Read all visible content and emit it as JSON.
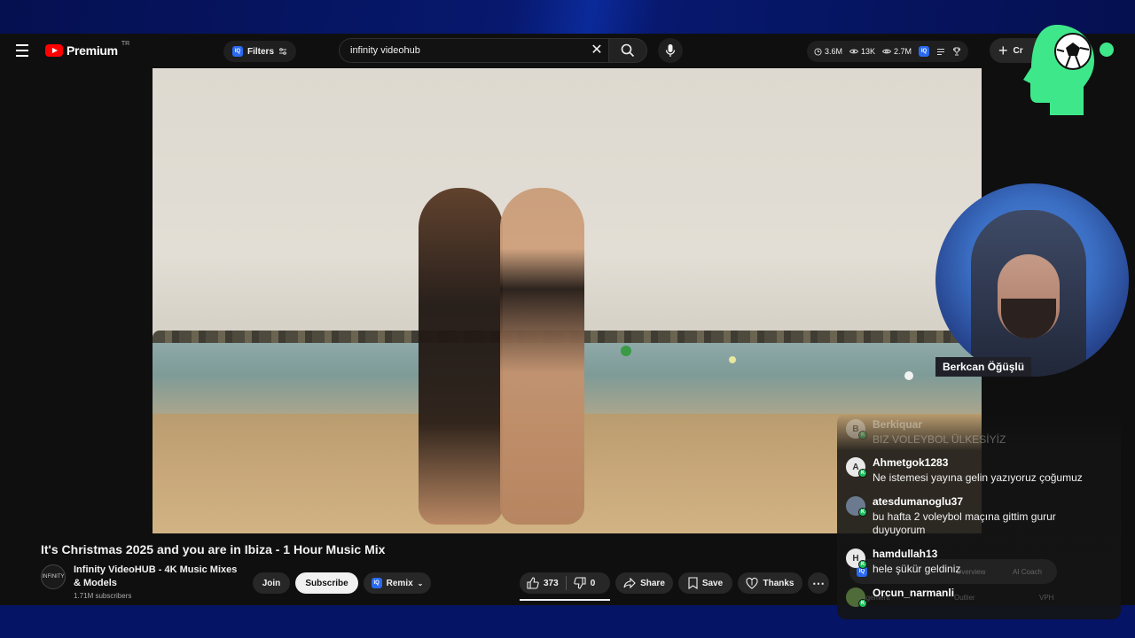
{
  "header": {
    "brand": "Premium",
    "region": "TR",
    "filters_label": "Filters",
    "search_value": "infinity videohub",
    "stats": [
      {
        "icon": "clock-icon",
        "value": "3.6M"
      },
      {
        "icon": "eye-icon",
        "value": "13K"
      },
      {
        "icon": "eye-outline-icon",
        "value": "2.7M"
      }
    ],
    "create_label": "Cr"
  },
  "video": {
    "title": "It's Christmas 2025 and you are in Ibiza - 1 Hour Music Mix",
    "channel": {
      "avatar_text": "INFINITY",
      "name": "Infinity VideoHUB - 4K Music Mixes & Models",
      "subscribers": "1.71M subscribers"
    },
    "actions": {
      "join": "Join",
      "subscribe": "Subscribe",
      "remix": "Remix",
      "likes": "373",
      "dislikes": "0",
      "share": "Share",
      "save": "Save",
      "thanks": "Thanks"
    }
  },
  "stream": {
    "streamer_name": "Berkcan Öğüşlü",
    "chat": [
      {
        "initial": "B",
        "user": "Berkiquar",
        "text": "BIZ VOLEYBOL ÜLKESİYİZ",
        "faded": true
      },
      {
        "initial": "A",
        "user": "Ahmetgok1283",
        "text": "Ne istemesi yayına gelin yazıyoruz çoğumuz",
        "faded": false
      },
      {
        "initial": "",
        "user": "atesdumanoglu37",
        "text": "bu hafta 2 voleybol maçına gittim gurur duyuyorum",
        "faded": false
      },
      {
        "initial": "H",
        "user": "hamdullah13",
        "text": "hele şükür geldiniz",
        "faded": false
      },
      {
        "initial": "",
        "user": "Orcun_narmanli",
        "text": "",
        "faded": false
      }
    ],
    "ghost_labels": [
      "Overview",
      "AI Coach",
      "Engagement",
      "Outlier",
      "VPH"
    ]
  },
  "colors": {
    "accent_red": "#ff0000",
    "brand_green": "#3ee88a",
    "background_blue": "#061466"
  }
}
